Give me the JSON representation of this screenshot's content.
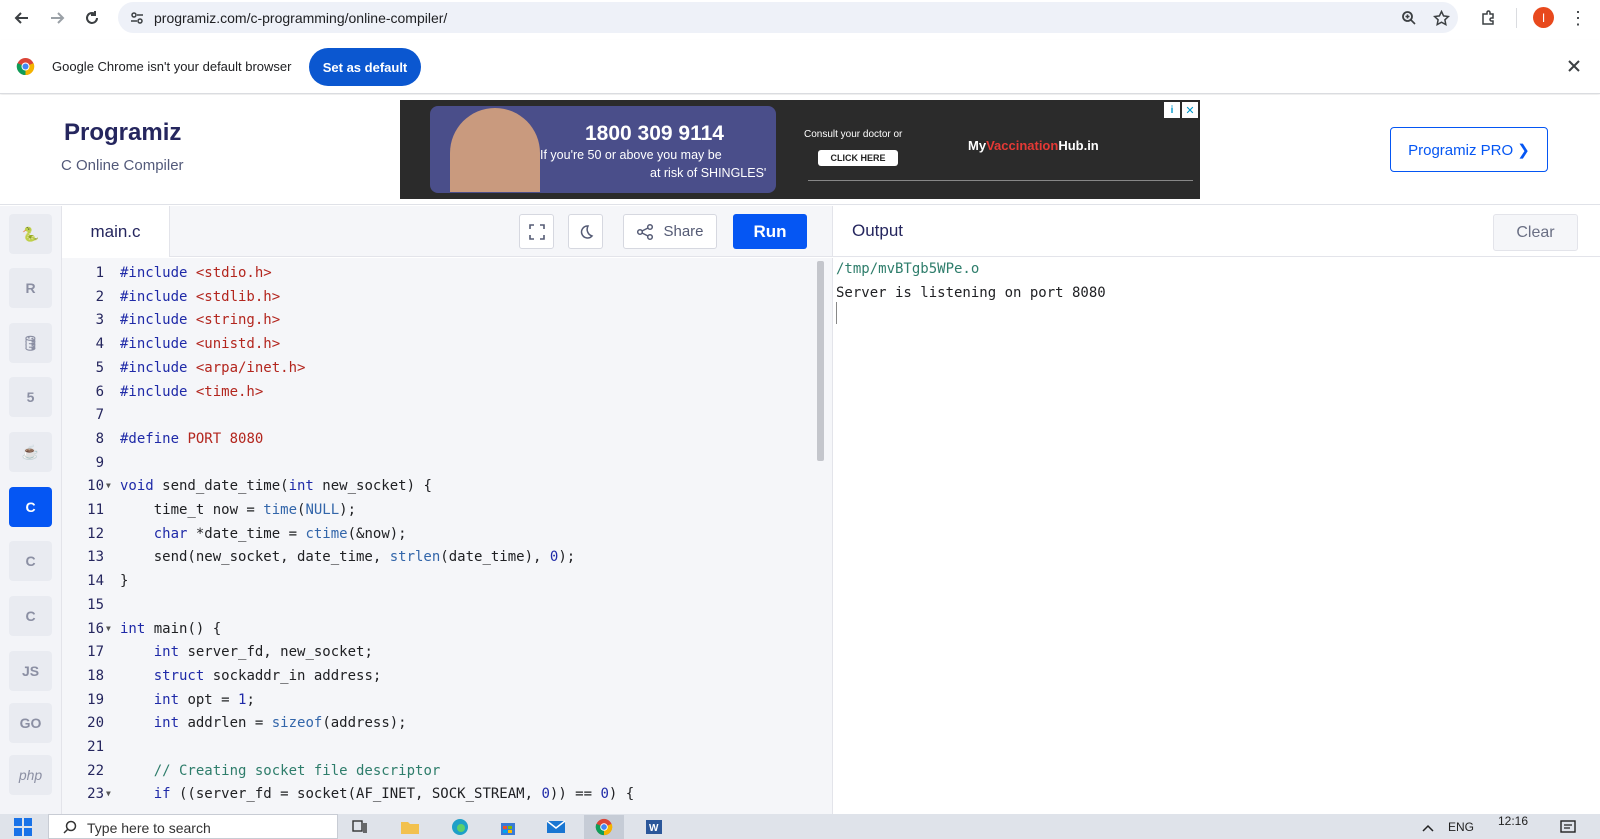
{
  "browser": {
    "url": "programiz.com/c-programming/online-compiler/",
    "profile_initial": "I"
  },
  "infobar": {
    "message": "Google Chrome isn't your default browser",
    "button": "Set as default"
  },
  "site": {
    "logo": "Programiz",
    "subtitle": "C Online Compiler",
    "pro_button": "Programiz PRO ❯",
    "ad": {
      "phone": "1800 309 9114",
      "line1": "If you're 50 or above you may be",
      "line2": "at risk of SHINGLES'",
      "consult": "Consult your doctor or",
      "cta": "CLICK HERE",
      "brand_prefix": "My",
      "brand_highlight": "Vaccination",
      "brand_suffix": "Hub.in"
    }
  },
  "languages": [
    {
      "name": "Python",
      "icon": "python-icon",
      "glyph": "🐍",
      "active": false
    },
    {
      "name": "R",
      "icon": "r-icon",
      "glyph": "R",
      "active": false
    },
    {
      "name": "SQL",
      "icon": "database-icon",
      "glyph": "🛢",
      "active": false
    },
    {
      "name": "HTML",
      "icon": "html5-icon",
      "glyph": "5",
      "active": false
    },
    {
      "name": "Java",
      "icon": "java-icon",
      "glyph": "☕",
      "active": false
    },
    {
      "name": "C",
      "icon": "c-icon",
      "glyph": "C",
      "active": true
    },
    {
      "name": "C++",
      "icon": "cpp-icon",
      "glyph": "C",
      "active": false
    },
    {
      "name": "C#",
      "icon": "csharp-icon",
      "glyph": "C",
      "active": false
    },
    {
      "name": "JS",
      "icon": "js-icon",
      "glyph": "JS",
      "active": false
    },
    {
      "name": "Go",
      "icon": "go-icon",
      "glyph": "GO",
      "active": false
    },
    {
      "name": "PHP",
      "icon": "php-icon",
      "glyph": "php",
      "active": false
    }
  ],
  "editor": {
    "filename": "main.c",
    "share": "Share",
    "run": "Run",
    "lines": [
      {
        "n": "1",
        "fold": false,
        "tokens": [
          [
            "pp",
            "#include "
          ],
          [
            "str",
            "<stdio.h>"
          ]
        ]
      },
      {
        "n": "2",
        "fold": false,
        "tokens": [
          [
            "pp",
            "#include "
          ],
          [
            "str",
            "<stdlib.h>"
          ]
        ]
      },
      {
        "n": "3",
        "fold": false,
        "tokens": [
          [
            "pp",
            "#include "
          ],
          [
            "str",
            "<string.h>"
          ]
        ]
      },
      {
        "n": "4",
        "fold": false,
        "tokens": [
          [
            "pp",
            "#include "
          ],
          [
            "str",
            "<unistd.h>"
          ]
        ]
      },
      {
        "n": "5",
        "fold": false,
        "tokens": [
          [
            "pp",
            "#include "
          ],
          [
            "str",
            "<arpa/inet.h>"
          ]
        ]
      },
      {
        "n": "6",
        "fold": false,
        "tokens": [
          [
            "pp",
            "#include "
          ],
          [
            "str",
            "<time.h>"
          ]
        ]
      },
      {
        "n": "7",
        "fold": false,
        "tokens": []
      },
      {
        "n": "8",
        "fold": false,
        "tokens": [
          [
            "pp",
            "#define "
          ],
          [
            "str",
            "PORT 8080"
          ]
        ]
      },
      {
        "n": "9",
        "fold": false,
        "tokens": []
      },
      {
        "n": "10",
        "fold": true,
        "tokens": [
          [
            "kw",
            "void"
          ],
          [
            "plain",
            " send_date_time("
          ],
          [
            "kw",
            "int"
          ],
          [
            "plain",
            " new_socket) {"
          ]
        ]
      },
      {
        "n": "11",
        "fold": false,
        "tokens": [
          [
            "plain",
            "    time_t now = "
          ],
          [
            "fn",
            "time"
          ],
          [
            "plain",
            "("
          ],
          [
            "const",
            "NULL"
          ],
          [
            "plain",
            ");"
          ]
        ]
      },
      {
        "n": "12",
        "fold": false,
        "tokens": [
          [
            "plain",
            "    "
          ],
          [
            "kw",
            "char"
          ],
          [
            "plain",
            " *date_time = "
          ],
          [
            "fn",
            "ctime"
          ],
          [
            "plain",
            "(&now);"
          ]
        ]
      },
      {
        "n": "13",
        "fold": false,
        "tokens": [
          [
            "plain",
            "    send(new_socket, date_time, "
          ],
          [
            "fn",
            "strlen"
          ],
          [
            "plain",
            "(date_time), "
          ],
          [
            "num",
            "0"
          ],
          [
            "plain",
            ");"
          ]
        ]
      },
      {
        "n": "14",
        "fold": false,
        "tokens": [
          [
            "plain",
            "}"
          ]
        ]
      },
      {
        "n": "15",
        "fold": false,
        "tokens": []
      },
      {
        "n": "16",
        "fold": true,
        "tokens": [
          [
            "kw",
            "int"
          ],
          [
            "plain",
            " main() {"
          ]
        ]
      },
      {
        "n": "17",
        "fold": false,
        "tokens": [
          [
            "plain",
            "    "
          ],
          [
            "kw",
            "int"
          ],
          [
            "plain",
            " server_fd, new_socket;"
          ]
        ]
      },
      {
        "n": "18",
        "fold": false,
        "tokens": [
          [
            "plain",
            "    "
          ],
          [
            "kw",
            "struct"
          ],
          [
            "plain",
            " sockaddr_in address;"
          ]
        ]
      },
      {
        "n": "19",
        "fold": false,
        "tokens": [
          [
            "plain",
            "    "
          ],
          [
            "kw",
            "int"
          ],
          [
            "plain",
            " opt = "
          ],
          [
            "num",
            "1"
          ],
          [
            "plain",
            ";"
          ]
        ]
      },
      {
        "n": "20",
        "fold": false,
        "tokens": [
          [
            "plain",
            "    "
          ],
          [
            "kw",
            "int"
          ],
          [
            "plain",
            " addrlen = "
          ],
          [
            "fn",
            "sizeof"
          ],
          [
            "plain",
            "(address);"
          ]
        ]
      },
      {
        "n": "21",
        "fold": false,
        "tokens": []
      },
      {
        "n": "22",
        "fold": false,
        "tokens": [
          [
            "plain",
            "    "
          ],
          [
            "cmt",
            "// Creating socket file descriptor"
          ]
        ]
      },
      {
        "n": "23",
        "fold": true,
        "tokens": [
          [
            "plain",
            "    "
          ],
          [
            "kw",
            "if"
          ],
          [
            "plain",
            " ((server_fd = socket(AF_INET, SOCK_STREAM, "
          ],
          [
            "num",
            "0"
          ],
          [
            "plain",
            ")) == "
          ],
          [
            "num",
            "0"
          ],
          [
            "plain",
            ") {"
          ]
        ]
      }
    ]
  },
  "output": {
    "title": "Output",
    "clear": "Clear",
    "lines": [
      "/tmp/mvBTgb5WPe.o",
      "Server is listening on port 8080"
    ]
  },
  "taskbar": {
    "search_placeholder": "Type here to search",
    "lang": "ENG",
    "time": "12:16"
  },
  "colors": {
    "accent": "#0556f3",
    "pp": "#1f2aa8",
    "str": "#b3261e",
    "kw": "#1f2aa8",
    "fn": "#3366aa",
    "num": "#1f2aa8",
    "const": "#3366aa",
    "cmt": "#2e7d6b",
    "plain": "#202124"
  }
}
